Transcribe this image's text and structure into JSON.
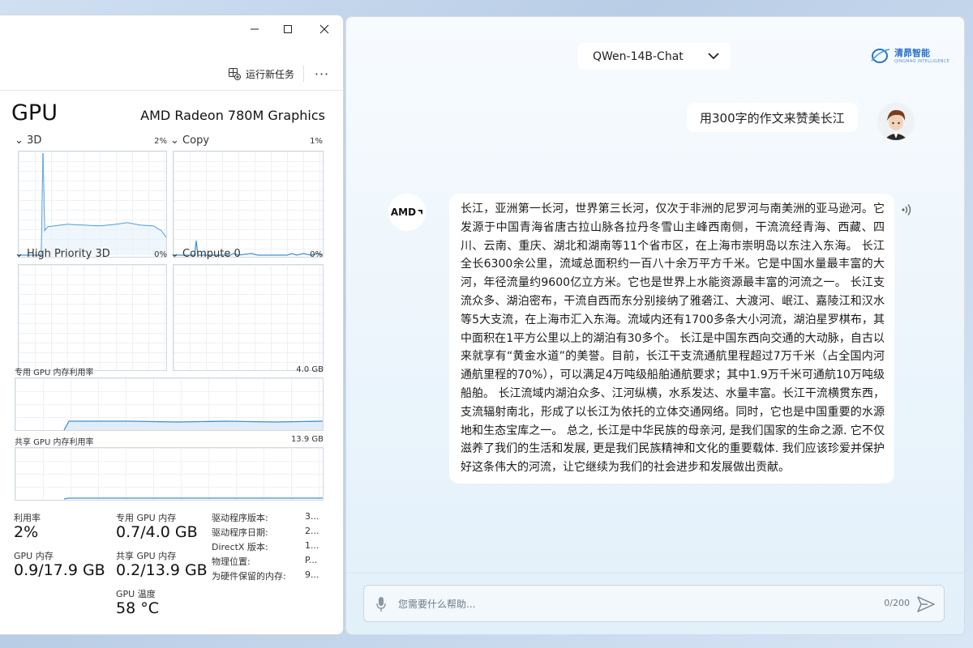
{
  "task_manager": {
    "toolbar": {
      "run_task_label": "运行新任务",
      "more_label": "···"
    },
    "gpu_title": "GPU",
    "gpu_model": "AMD Radeon 780M Graphics",
    "engines": [
      {
        "label": "3D",
        "pct": "2%"
      },
      {
        "label": "Copy",
        "pct": "1%"
      },
      {
        "label": "High Priority 3D",
        "pct": "0%"
      },
      {
        "label": "Compute 0",
        "pct": "0%"
      }
    ],
    "dedicated_mem": {
      "label": "专用 GPU 内存利用率",
      "max": "4.0 GB"
    },
    "shared_mem": {
      "label": "共享 GPU 内存利用率",
      "max": "13.9 GB"
    },
    "stats": [
      {
        "label": "利用率",
        "value": "2%"
      },
      {
        "label": "专用 GPU 内存",
        "value": "0.7/4.0 GB"
      },
      {
        "label": "GPU 内存",
        "value": "0.9/17.9 GB"
      },
      {
        "label": "共享 GPU 内存",
        "value": "0.2/13.9 GB"
      },
      {
        "label": "GPU 温度",
        "value": "58 °C"
      }
    ],
    "info": [
      {
        "key": "驱动程序版本:",
        "value": "3..."
      },
      {
        "key": "驱动程序日期:",
        "value": "2..."
      },
      {
        "key": "DirectX 版本:",
        "value": "1..."
      },
      {
        "key": "物理位置:",
        "value": "P..."
      },
      {
        "key": "为硬件保留的内存:",
        "value": "9..."
      }
    ]
  },
  "chat": {
    "model_select": "QWen-14B-Chat",
    "brand_name": "清昴智能",
    "brand_sub": "QINGMAO INTELLIGENCE",
    "user_message": "用300字的作文来赞美长江",
    "bot_avatar_text": "AMD",
    "bot_message": "长江，亚洲第一长河，世界第三长河，仅次于非洲的尼罗河与南美洲的亚马逊河。它发源于中国青海省唐古拉山脉各拉丹冬雪山主峰西南侧，干流流经青海、西藏、四川、云南、重庆、湖北和湖南等11个省市区，在上海市崇明岛以东注入东海。 长江全长6300余公里，流域总面积约一百八十余万平方千米。它是中国水量最丰富的大河，年径流量约9600亿立方米。它也是世界上水能资源最丰富的河流之一。 长江支流众多、湖泊密布，干流自西而东分别接纳了雅砻江、大渡河、岷江、嘉陵江和汉水等5大支流，在上海市汇入东海。流域内还有1700多条大小河流，湖泊星罗棋布，其中面积在1平方公里以上的湖泊有30多个。 长江是中国东西向交通的大动脉，自古以来就享有“黄金水道”的美誉。目前，长江干支流通航里程超过7万千米（占全国内河通航里程的70%），可以满足4万吨级船舶通航要求；其中1.9万千米可通航10万吨级船舶。 长江流域内湖泊众多、江河纵横，水系发达、水量丰富。长江干流横贯东西，支流辐射南北，形成了以长江为依托的立体交通网络。同时，它也是中国重要的水源地和生态宝库之一。 总之, 长江是中华民族的母亲河, 是我们国家的生命之源. 它不仅滋养了我们的生活和发展, 更是我们民族精神和文化的重要载体. 我们应该珍爱并保护好这条伟大的河流，让它继续为我们的社会进步和发展做出贡献。",
    "input_placeholder": "您需要什么帮助...",
    "char_count": "0/200"
  }
}
